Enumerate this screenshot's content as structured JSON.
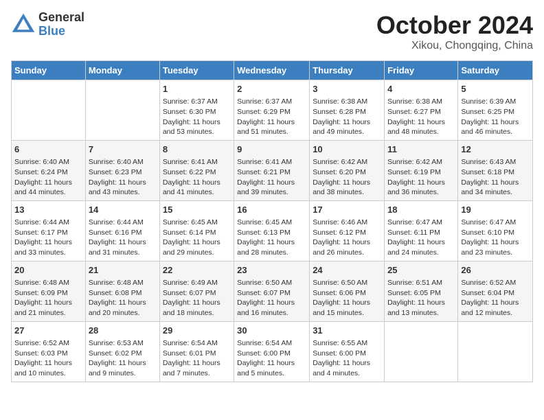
{
  "logo": {
    "line1": "General",
    "line2": "Blue"
  },
  "title": "October 2024",
  "subtitle": "Xikou, Chongqing, China",
  "days_of_week": [
    "Sunday",
    "Monday",
    "Tuesday",
    "Wednesday",
    "Thursday",
    "Friday",
    "Saturday"
  ],
  "weeks": [
    [
      {
        "day": "",
        "info": ""
      },
      {
        "day": "",
        "info": ""
      },
      {
        "day": "1",
        "info": "Sunrise: 6:37 AM\nSunset: 6:30 PM\nDaylight: 11 hours and 53 minutes."
      },
      {
        "day": "2",
        "info": "Sunrise: 6:37 AM\nSunset: 6:29 PM\nDaylight: 11 hours and 51 minutes."
      },
      {
        "day": "3",
        "info": "Sunrise: 6:38 AM\nSunset: 6:28 PM\nDaylight: 11 hours and 49 minutes."
      },
      {
        "day": "4",
        "info": "Sunrise: 6:38 AM\nSunset: 6:27 PM\nDaylight: 11 hours and 48 minutes."
      },
      {
        "day": "5",
        "info": "Sunrise: 6:39 AM\nSunset: 6:25 PM\nDaylight: 11 hours and 46 minutes."
      }
    ],
    [
      {
        "day": "6",
        "info": "Sunrise: 6:40 AM\nSunset: 6:24 PM\nDaylight: 11 hours and 44 minutes."
      },
      {
        "day": "7",
        "info": "Sunrise: 6:40 AM\nSunset: 6:23 PM\nDaylight: 11 hours and 43 minutes."
      },
      {
        "day": "8",
        "info": "Sunrise: 6:41 AM\nSunset: 6:22 PM\nDaylight: 11 hours and 41 minutes."
      },
      {
        "day": "9",
        "info": "Sunrise: 6:41 AM\nSunset: 6:21 PM\nDaylight: 11 hours and 39 minutes."
      },
      {
        "day": "10",
        "info": "Sunrise: 6:42 AM\nSunset: 6:20 PM\nDaylight: 11 hours and 38 minutes."
      },
      {
        "day": "11",
        "info": "Sunrise: 6:42 AM\nSunset: 6:19 PM\nDaylight: 11 hours and 36 minutes."
      },
      {
        "day": "12",
        "info": "Sunrise: 6:43 AM\nSunset: 6:18 PM\nDaylight: 11 hours and 34 minutes."
      }
    ],
    [
      {
        "day": "13",
        "info": "Sunrise: 6:44 AM\nSunset: 6:17 PM\nDaylight: 11 hours and 33 minutes."
      },
      {
        "day": "14",
        "info": "Sunrise: 6:44 AM\nSunset: 6:16 PM\nDaylight: 11 hours and 31 minutes."
      },
      {
        "day": "15",
        "info": "Sunrise: 6:45 AM\nSunset: 6:14 PM\nDaylight: 11 hours and 29 minutes."
      },
      {
        "day": "16",
        "info": "Sunrise: 6:45 AM\nSunset: 6:13 PM\nDaylight: 11 hours and 28 minutes."
      },
      {
        "day": "17",
        "info": "Sunrise: 6:46 AM\nSunset: 6:12 PM\nDaylight: 11 hours and 26 minutes."
      },
      {
        "day": "18",
        "info": "Sunrise: 6:47 AM\nSunset: 6:11 PM\nDaylight: 11 hours and 24 minutes."
      },
      {
        "day": "19",
        "info": "Sunrise: 6:47 AM\nSunset: 6:10 PM\nDaylight: 11 hours and 23 minutes."
      }
    ],
    [
      {
        "day": "20",
        "info": "Sunrise: 6:48 AM\nSunset: 6:09 PM\nDaylight: 11 hours and 21 minutes."
      },
      {
        "day": "21",
        "info": "Sunrise: 6:48 AM\nSunset: 6:08 PM\nDaylight: 11 hours and 20 minutes."
      },
      {
        "day": "22",
        "info": "Sunrise: 6:49 AM\nSunset: 6:07 PM\nDaylight: 11 hours and 18 minutes."
      },
      {
        "day": "23",
        "info": "Sunrise: 6:50 AM\nSunset: 6:07 PM\nDaylight: 11 hours and 16 minutes."
      },
      {
        "day": "24",
        "info": "Sunrise: 6:50 AM\nSunset: 6:06 PM\nDaylight: 11 hours and 15 minutes."
      },
      {
        "day": "25",
        "info": "Sunrise: 6:51 AM\nSunset: 6:05 PM\nDaylight: 11 hours and 13 minutes."
      },
      {
        "day": "26",
        "info": "Sunrise: 6:52 AM\nSunset: 6:04 PM\nDaylight: 11 hours and 12 minutes."
      }
    ],
    [
      {
        "day": "27",
        "info": "Sunrise: 6:52 AM\nSunset: 6:03 PM\nDaylight: 11 hours and 10 minutes."
      },
      {
        "day": "28",
        "info": "Sunrise: 6:53 AM\nSunset: 6:02 PM\nDaylight: 11 hours and 9 minutes."
      },
      {
        "day": "29",
        "info": "Sunrise: 6:54 AM\nSunset: 6:01 PM\nDaylight: 11 hours and 7 minutes."
      },
      {
        "day": "30",
        "info": "Sunrise: 6:54 AM\nSunset: 6:00 PM\nDaylight: 11 hours and 5 minutes."
      },
      {
        "day": "31",
        "info": "Sunrise: 6:55 AM\nSunset: 6:00 PM\nDaylight: 11 hours and 4 minutes."
      },
      {
        "day": "",
        "info": ""
      },
      {
        "day": "",
        "info": ""
      }
    ]
  ]
}
